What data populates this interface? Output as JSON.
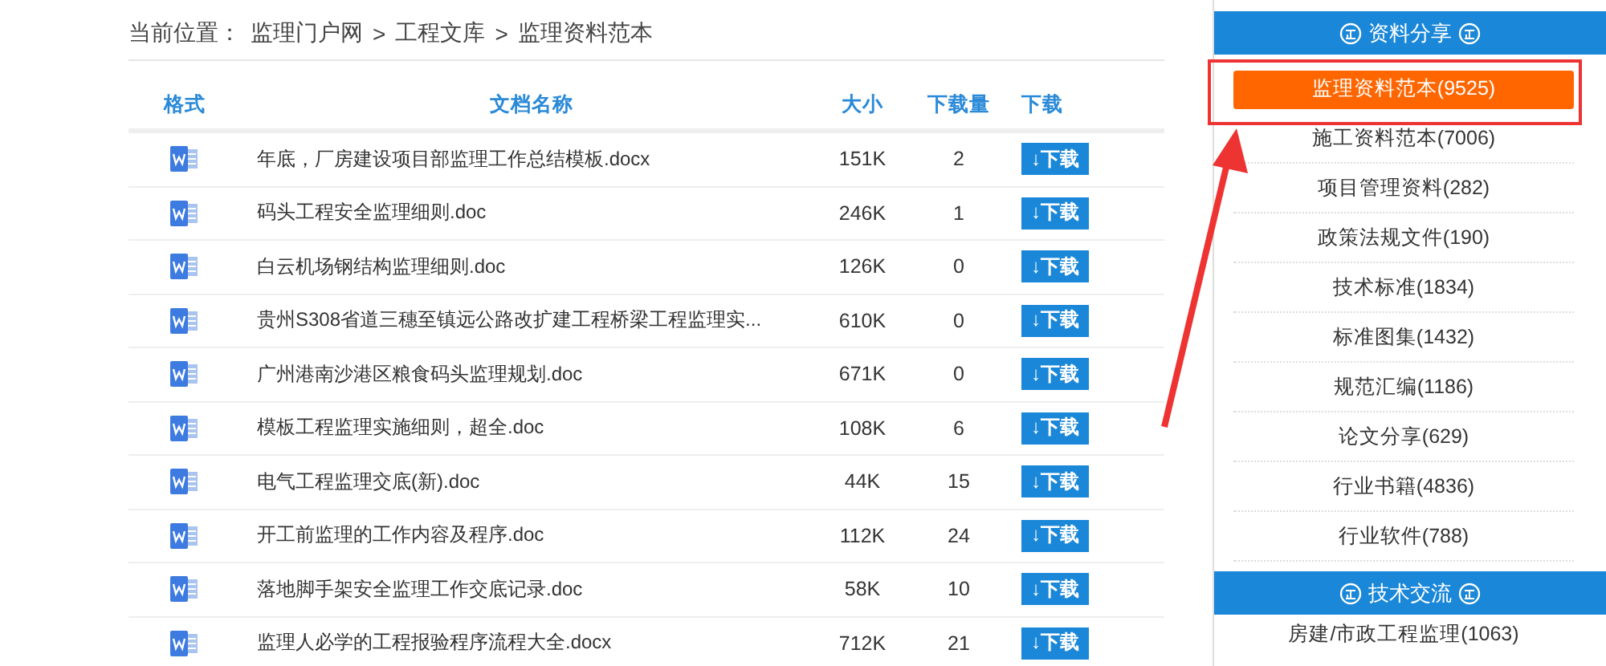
{
  "breadcrumb": {
    "label": "当前位置：",
    "path": [
      "监理门户网",
      ">",
      "工程文库",
      ">",
      "监理资料范本"
    ]
  },
  "table": {
    "columns": [
      "格式",
      "文档名称",
      "大小",
      "下载量",
      "下载"
    ],
    "rows": [
      {
        "name": "年底，厂房建设项目部监理工作总结模板.docx",
        "size": "151K",
        "downloads": "2",
        "button": "↓下载"
      },
      {
        "name": "码头工程安全监理细则.doc",
        "size": "246K",
        "downloads": "1",
        "button": "↓下载"
      },
      {
        "name": "白云机场钢结构监理细则.doc",
        "size": "126K",
        "downloads": "0",
        "button": "↓下载"
      },
      {
        "name": "贵州S308省道三穗至镇远公路改扩建工程桥梁工程监理实...",
        "size": "610K",
        "downloads": "0",
        "button": "↓下载"
      },
      {
        "name": "广州港南沙港区粮食码头监理规划.doc",
        "size": "671K",
        "downloads": "0",
        "button": "↓下载"
      },
      {
        "name": "模板工程监理实施细则，超全.doc",
        "size": "108K",
        "downloads": "6",
        "button": "↓下载"
      },
      {
        "name": "电气工程监理交底(新).doc",
        "size": "44K",
        "downloads": "15",
        "button": "↓下载"
      },
      {
        "name": "开工前监理的工作内容及程序.doc",
        "size": "112K",
        "downloads": "24",
        "button": "↓下载"
      },
      {
        "name": "落地脚手架安全监理工作交底记录.doc",
        "size": "58K",
        "downloads": "10",
        "button": "↓下载"
      },
      {
        "name": "监理人必学的工程报验程序流程大全.docx",
        "size": "712K",
        "downloads": "21",
        "button": "↓下载"
      }
    ]
  },
  "sidebar": [
    {
      "title": "资料分享",
      "items": [
        {
          "label": "监理资料范本(9525)",
          "selected": true
        },
        {
          "label": "施工资料范本(7006)",
          "selected": false
        },
        {
          "label": "项目管理资料(282)",
          "selected": false
        },
        {
          "label": "政策法规文件(190)",
          "selected": false
        },
        {
          "label": "技术标准(1834)",
          "selected": false
        },
        {
          "label": "标准图集(1432)",
          "selected": false
        },
        {
          "label": "规范汇编(1186)",
          "selected": false
        },
        {
          "label": "论文分享(629)",
          "selected": false
        },
        {
          "label": "行业书籍(4836)",
          "selected": false
        },
        {
          "label": "行业软件(788)",
          "selected": false
        }
      ]
    },
    {
      "title": "技术交流",
      "items": [
        {
          "label": "房建/市政工程监理(1063)",
          "selected": false
        }
      ]
    }
  ]
}
